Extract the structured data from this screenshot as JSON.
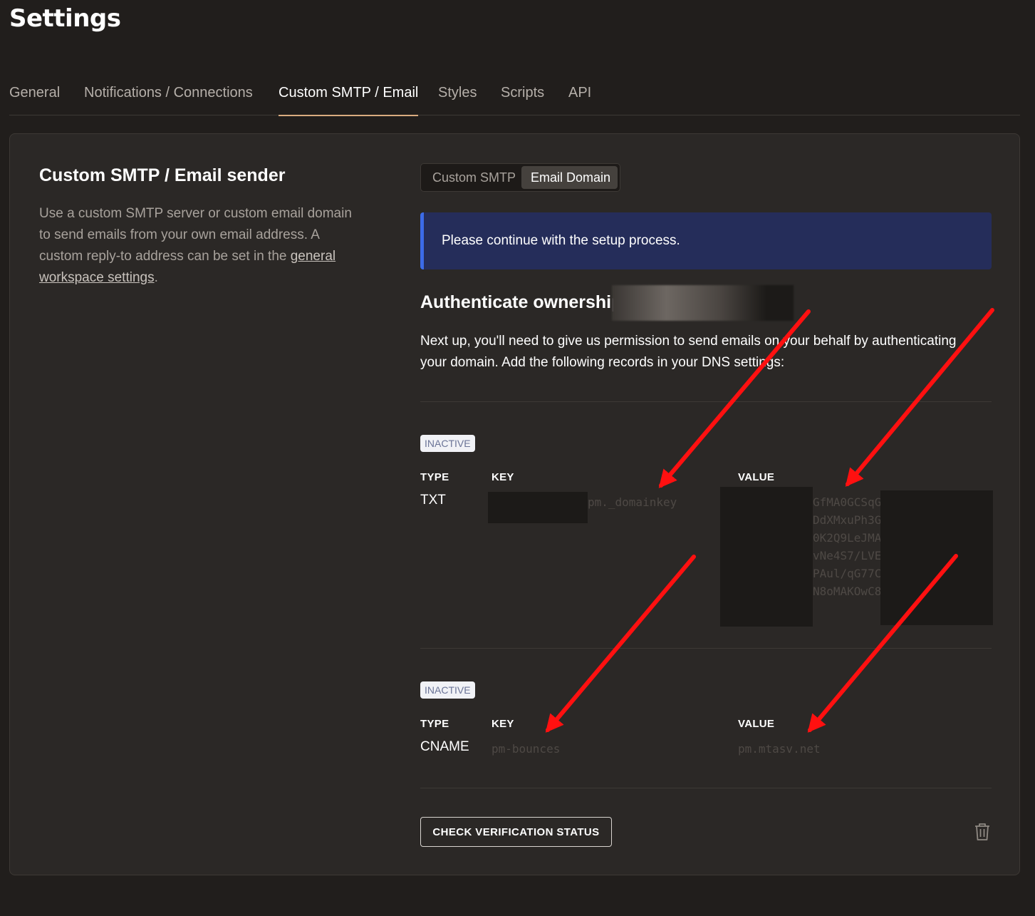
{
  "page_title": "Settings",
  "tabs": [
    {
      "label": "General",
      "active": false
    },
    {
      "label": "Notifications / Connections",
      "active": false
    },
    {
      "label": "Custom SMTP / Email",
      "active": true
    },
    {
      "label": "Styles",
      "active": false
    },
    {
      "label": "Scripts",
      "active": false
    },
    {
      "label": "API",
      "active": false
    }
  ],
  "sidebar": {
    "title": "Custom SMTP / Email sender",
    "description": "Use a custom SMTP server or custom email domain to send emails from your own email address. A custom reply-to address can be set in the ",
    "link_text": "general workspace settings",
    "description_end": "."
  },
  "segment": {
    "options": [
      "Custom SMTP",
      "Email Domain"
    ],
    "selected": "Email Domain"
  },
  "alert": {
    "text": "Please continue with the setup process."
  },
  "auth": {
    "title": "Authenticate ownership",
    "description": "Next up, you'll need to give us permission to send emails on your behalf by authenticating your domain. Add the following records in your DNS settings:"
  },
  "records": [
    {
      "status": "INACTIVE",
      "type_label": "TYPE",
      "key_label": "KEY",
      "value_label": "VALUE",
      "type": "TXT",
      "key": "pm._domainkey",
      "value_lines": [
        "GfMA0GCSqG",
        "DdXMxuPh3G",
        "0K2Q9LeJMA",
        "vNe4S7/LVE",
        "PAul/qG77C",
        "N8oMAKOwC8"
      ]
    },
    {
      "status": "INACTIVE",
      "type_label": "TYPE",
      "key_label": "KEY",
      "value_label": "VALUE",
      "type": "CNAME",
      "key": "pm-bounces",
      "value": "pm.mtasv.net"
    }
  ],
  "actions": {
    "check_label": "CHECK VERIFICATION STATUS"
  },
  "icons": {
    "delete": "trash-icon"
  },
  "colors": {
    "background": "#211e1c",
    "card": "#2b2826",
    "accent_tab": "#d9ab7f",
    "alert_bg": "#252d5a",
    "alert_border": "#3c6be8",
    "annotation_arrow": "#ff0000"
  }
}
